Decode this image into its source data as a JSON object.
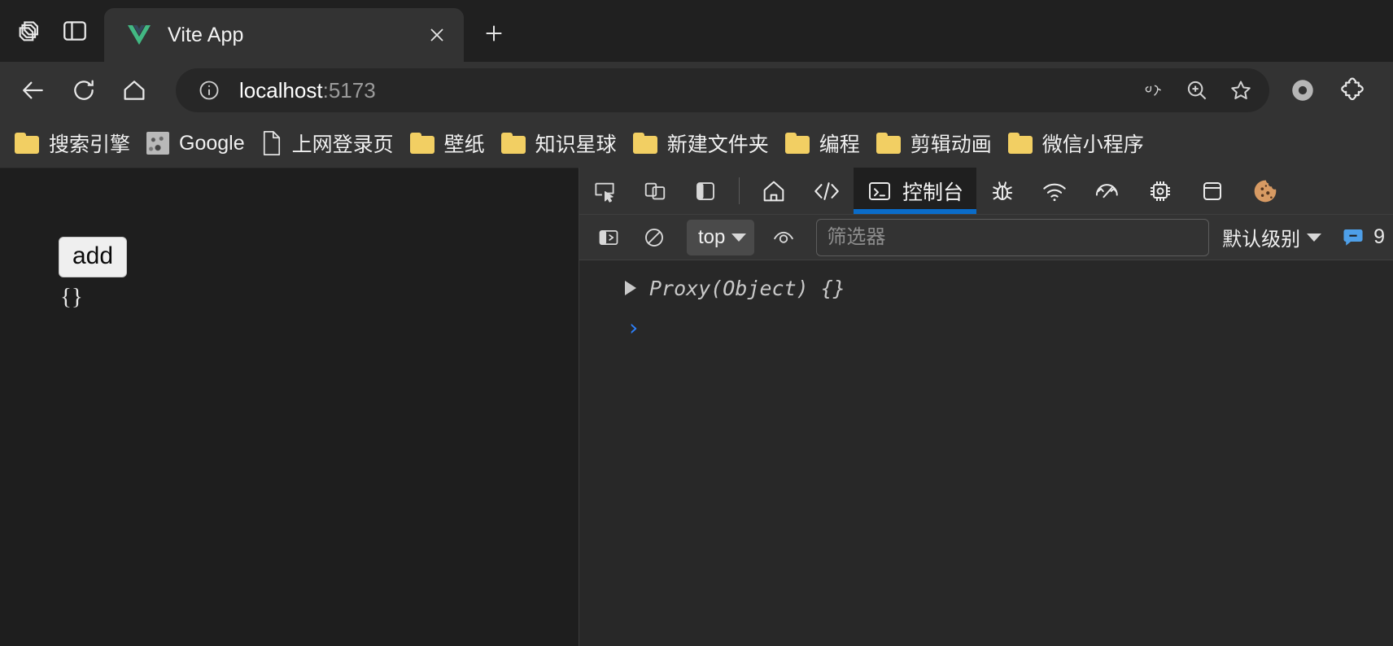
{
  "window": {
    "system_buttons": [
      "tab-copilot-icon",
      "tab-split-screen-icon"
    ]
  },
  "tabs": [
    {
      "title": "Vite App",
      "favicon": "vue-logo-icon",
      "close_label": "×"
    }
  ],
  "new_tab_label": "+",
  "navigation": {
    "back_icon": "back-arrow-icon",
    "reload_icon": "reload-icon",
    "home_icon": "home-icon",
    "url_display": "localhost",
    "url_port": ":5173",
    "site_info_icon": "info-circle-icon",
    "actions": [
      {
        "name": "read-aloud-icon",
        "glyph": "あ"
      },
      {
        "name": "zoom-in-icon",
        "glyph": "search-plus"
      },
      {
        "name": "favorite-star-icon",
        "glyph": "star"
      },
      {
        "name": "profile-avatar-icon",
        "glyph": "circle"
      },
      {
        "name": "extensions-puzzle-icon",
        "glyph": "puzzle"
      }
    ]
  },
  "bookmarks": [
    {
      "label": "搜索引擎",
      "icon": "folder-icon"
    },
    {
      "label": "Google",
      "icon": "site-favicon"
    },
    {
      "label": "上网登录页",
      "icon": "page-icon"
    },
    {
      "label": "壁纸",
      "icon": "folder-icon"
    },
    {
      "label": "知识星球",
      "icon": "folder-icon"
    },
    {
      "label": "新建文件夹",
      "icon": "folder-icon"
    },
    {
      "label": "编程",
      "icon": "folder-icon"
    },
    {
      "label": "剪辑动画",
      "icon": "folder-icon"
    },
    {
      "label": "微信小程序",
      "icon": "folder-icon"
    }
  ],
  "page": {
    "add_button_label": "add",
    "object_text": "{}"
  },
  "devtools": {
    "left_tools": [
      {
        "name": "inspect-element-icon"
      },
      {
        "name": "device-toolbar-icon"
      },
      {
        "name": "dock-side-icon"
      }
    ],
    "tabs": [
      {
        "label": "",
        "icon": "home-icon",
        "active": false,
        "name": "tab-welcome"
      },
      {
        "label": "",
        "icon": "code-elements-icon",
        "active": false,
        "name": "tab-elements"
      },
      {
        "label": "控制台",
        "icon": "console-icon",
        "active": true,
        "name": "tab-console"
      },
      {
        "label": "",
        "icon": "bug-sources-icon",
        "active": false,
        "name": "tab-sources"
      },
      {
        "label": "",
        "icon": "network-wifi-icon",
        "active": false,
        "name": "tab-network"
      },
      {
        "label": "",
        "icon": "performance-gauge-icon",
        "active": false,
        "name": "tab-performance"
      },
      {
        "label": "",
        "icon": "memory-chip-icon",
        "active": false,
        "name": "tab-memory"
      },
      {
        "label": "",
        "icon": "application-panel-icon",
        "active": false,
        "name": "tab-application"
      },
      {
        "label": "",
        "icon": "cookie-icon",
        "active": false,
        "name": "tab-privacy"
      }
    ],
    "filter_bar": {
      "sidebar_toggle_icon": "console-sidebar-icon",
      "clear_console_icon": "clear-console-icon",
      "context_label": "top",
      "live_expression_icon": "eye-live-expression-icon",
      "filter_placeholder": "筛选器",
      "filter_value": "",
      "level_label": "默认级别",
      "message_count": "9",
      "message_count_icon": "issues-bubble-icon"
    },
    "console_messages": [
      {
        "expandable": true,
        "text": "Proxy(Object) {}"
      }
    ],
    "prompt_symbol": "›"
  },
  "colors": {
    "chrome_bg": "#333333",
    "window_bg": "#202020",
    "tab_active_bg": "#333333",
    "devtools_bg": "#282828",
    "accent_blue": "#0a6cc9",
    "folder_yellow": "#f2cf63",
    "vue_green": "#42b883",
    "vue_dark": "#35495e"
  }
}
